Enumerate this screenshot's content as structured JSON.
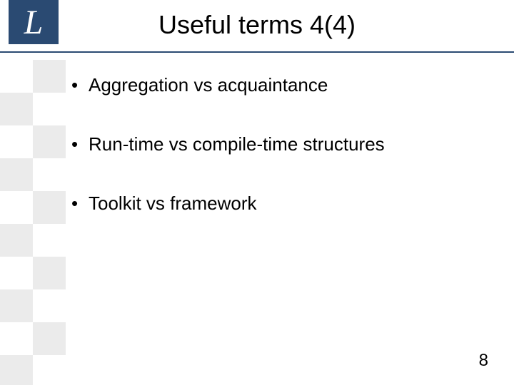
{
  "logo": {
    "letter": "L"
  },
  "title": "Useful terms 4(4)",
  "bullets": [
    "Aggregation vs acquaintance",
    "Run-time vs compile-time structures",
    "Toolkit vs framework"
  ],
  "pageNumber": "8"
}
